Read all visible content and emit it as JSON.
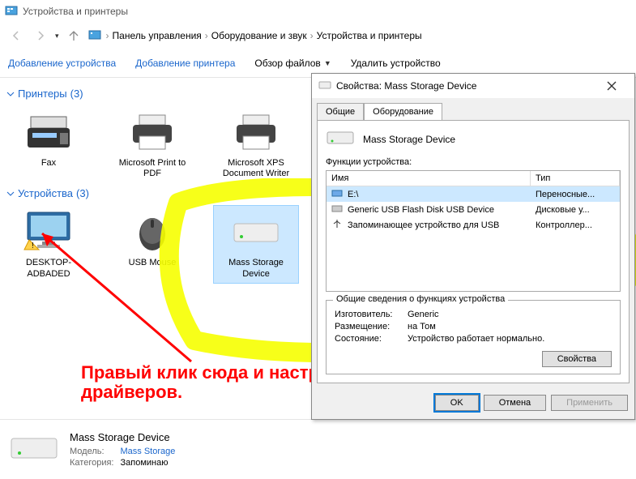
{
  "window": {
    "title": "Устройства и принтеры"
  },
  "breadcrumb": {
    "items": [
      "Панель управления",
      "Оборудование и звук",
      "Устройства и принтеры"
    ]
  },
  "toolbar": {
    "add_device": "Добавление устройства",
    "add_printer": "Добавление принтера",
    "browse_files": "Обзор файлов",
    "remove_device": "Удалить устройство"
  },
  "sections": {
    "printers": {
      "label": "Принтеры",
      "count": "(3)"
    },
    "devices": {
      "label": "Устройства",
      "count": "(3)"
    }
  },
  "printers": [
    {
      "name": "Fax"
    },
    {
      "name": "Microsoft Print to PDF"
    },
    {
      "name": "Microsoft XPS Document Writer"
    }
  ],
  "devices": [
    {
      "name": "DESKTOP-ADBADED"
    },
    {
      "name": "USB Mouse"
    },
    {
      "name": "Mass Storage Device"
    }
  ],
  "statusbar": {
    "name": "Mass Storage Device",
    "model_label": "Модель:",
    "model": "Mass Storage",
    "category_label": "Категория:",
    "category": "Запоминаю"
  },
  "dialog": {
    "title": "Свойства: Mass Storage Device",
    "tabs": {
      "general": "Общие",
      "hardware": "Оборудование"
    },
    "device_name": "Mass Storage Device",
    "functions_label": "Функции устройства:",
    "columns": {
      "name": "Имя",
      "type": "Тип"
    },
    "rows": [
      {
        "name": "E:\\",
        "type": "Переносные..."
      },
      {
        "name": "Generic USB Flash Disk USB Device",
        "type": "Дисковые у..."
      },
      {
        "name": "Запоминающее устройство для USB",
        "type": "Контроллер..."
      }
    ],
    "info": {
      "legend": "Общие сведения о функциях устройства",
      "manufacturer_label": "Изготовитель:",
      "manufacturer": "Generic",
      "location_label": "Размещение:",
      "location": "на Том",
      "status_label": "Состояние:",
      "status": "Устройство работает нормально."
    },
    "properties_btn": "Свойства",
    "ok": "OK",
    "cancel": "Отмена",
    "apply": "Применить"
  },
  "annotation": {
    "text": "Правый клик сюда и настроить автоматическую установку драйверов."
  }
}
